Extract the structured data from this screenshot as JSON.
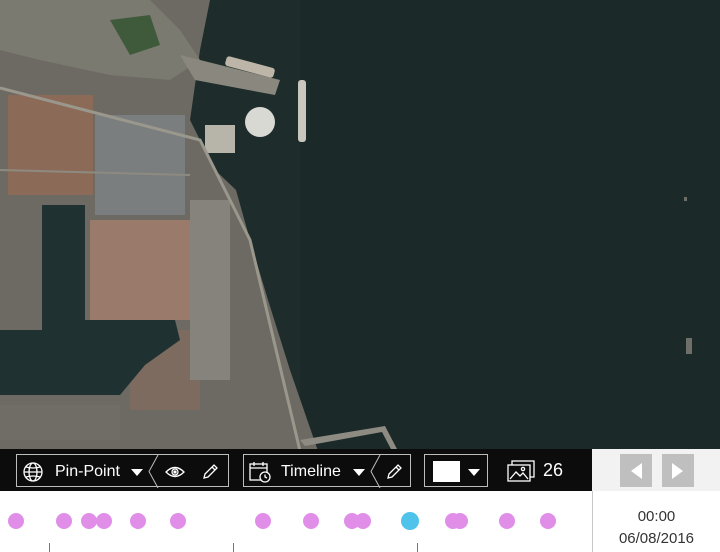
{
  "toolbar": {
    "layer_label": "Pin-Point",
    "timeline_label": "Timeline",
    "image_count": "26",
    "color_swatch": "#ffffff"
  },
  "icons": {
    "globe": "globe-icon",
    "eye": "eye-icon",
    "pencil": "pencil-icon",
    "calendar": "calendar-clock-icon",
    "images": "images-icon",
    "prev": "triangle-left-icon",
    "next": "triangle-right-icon"
  },
  "timeline": {
    "time": "00:00",
    "date": "06/08/2016",
    "dot_color": "#e08ee8",
    "active_color": "#4fc3ea"
  },
  "colors": {
    "toolbar_bg": "#0c0c0c",
    "nav_bg": "#f2f2f2",
    "nav_button": "#bfbfbf"
  }
}
